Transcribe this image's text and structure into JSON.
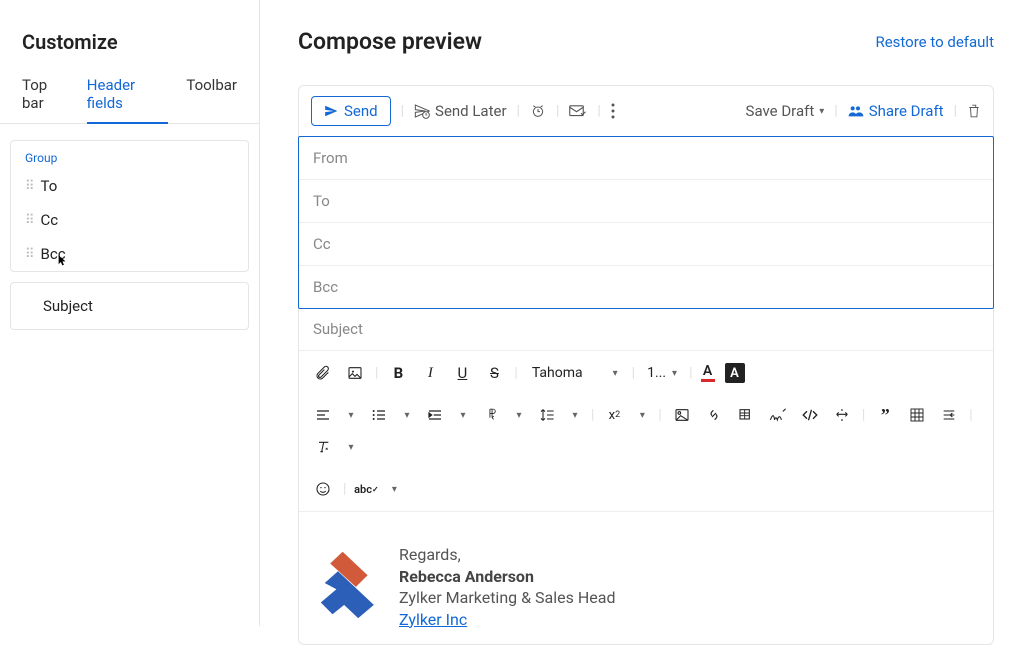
{
  "sidebar": {
    "title": "Customize",
    "tabs": [
      "Top bar",
      "Header fields",
      "Toolbar"
    ],
    "active_tab": 1,
    "group_label": "Group",
    "group_items": [
      "To",
      "Cc",
      "Bcc"
    ],
    "subject_item": "Subject"
  },
  "main": {
    "title": "Compose preview",
    "restore": "Restore to default"
  },
  "toolbar": {
    "send": "Send",
    "send_later": "Send Later",
    "save_draft": "Save Draft",
    "share_draft": "Share Draft"
  },
  "fields": {
    "from": "From",
    "to": "To",
    "cc": "Cc",
    "bcc": "Bcc",
    "subject": "Subject"
  },
  "editor": {
    "font": "Tahoma",
    "size": "1..."
  },
  "signature": {
    "regards": "Regards,",
    "name": "Rebecca Anderson",
    "title": "Zylker Marketing & Sales Head",
    "company": "Zylker Inc"
  }
}
